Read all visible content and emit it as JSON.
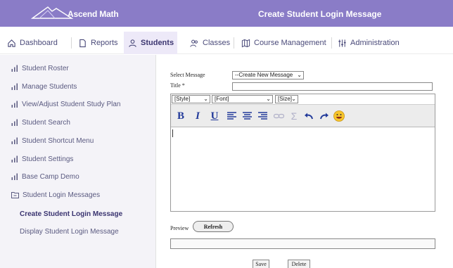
{
  "header": {
    "brand": "Ascend Math",
    "title": "Create Student Login Message",
    "color": "#8a7cc7"
  },
  "nav": {
    "items": [
      {
        "label": "Dashboard",
        "icon": "home-icon"
      },
      {
        "label": "Reports",
        "icon": "document-icon"
      },
      {
        "label": "Students",
        "icon": "person-icon",
        "active": true
      },
      {
        "label": "Classes",
        "icon": "people-icon"
      },
      {
        "label": "Course Management",
        "icon": "map-icon"
      },
      {
        "label": "Administration",
        "icon": "sliders-icon"
      }
    ]
  },
  "sidebar": {
    "items": [
      {
        "label": "Student Roster",
        "icon": "bar-chart-icon"
      },
      {
        "label": "Manage Students",
        "icon": "bar-chart-icon"
      },
      {
        "label": "View/Adjust Student Study Plan",
        "icon": "bar-chart-icon"
      },
      {
        "label": "Student Search",
        "icon": "bar-chart-icon"
      },
      {
        "label": "Student Shortcut Menu",
        "icon": "bar-chart-icon"
      },
      {
        "label": "Student Settings",
        "icon": "bar-chart-icon"
      },
      {
        "label": "Base Camp Demo",
        "icon": "bar-chart-icon"
      },
      {
        "label": "Student Login Messages",
        "icon": "folder-minus-icon"
      }
    ],
    "subitems": [
      {
        "label": "Create Student Login Message",
        "active": true
      },
      {
        "label": "Display Student Login Message"
      }
    ]
  },
  "form": {
    "select_message_label": "Select Message",
    "select_message_value": "--Create New Message",
    "title_label": "Title *",
    "title_value": "",
    "style_value": "[Style]",
    "font_value": "[Font]",
    "size_value": "[Size]",
    "preview_label": "Preview",
    "refresh_label": "Refresh",
    "save_label": "Save",
    "delete_label": "Delete"
  }
}
